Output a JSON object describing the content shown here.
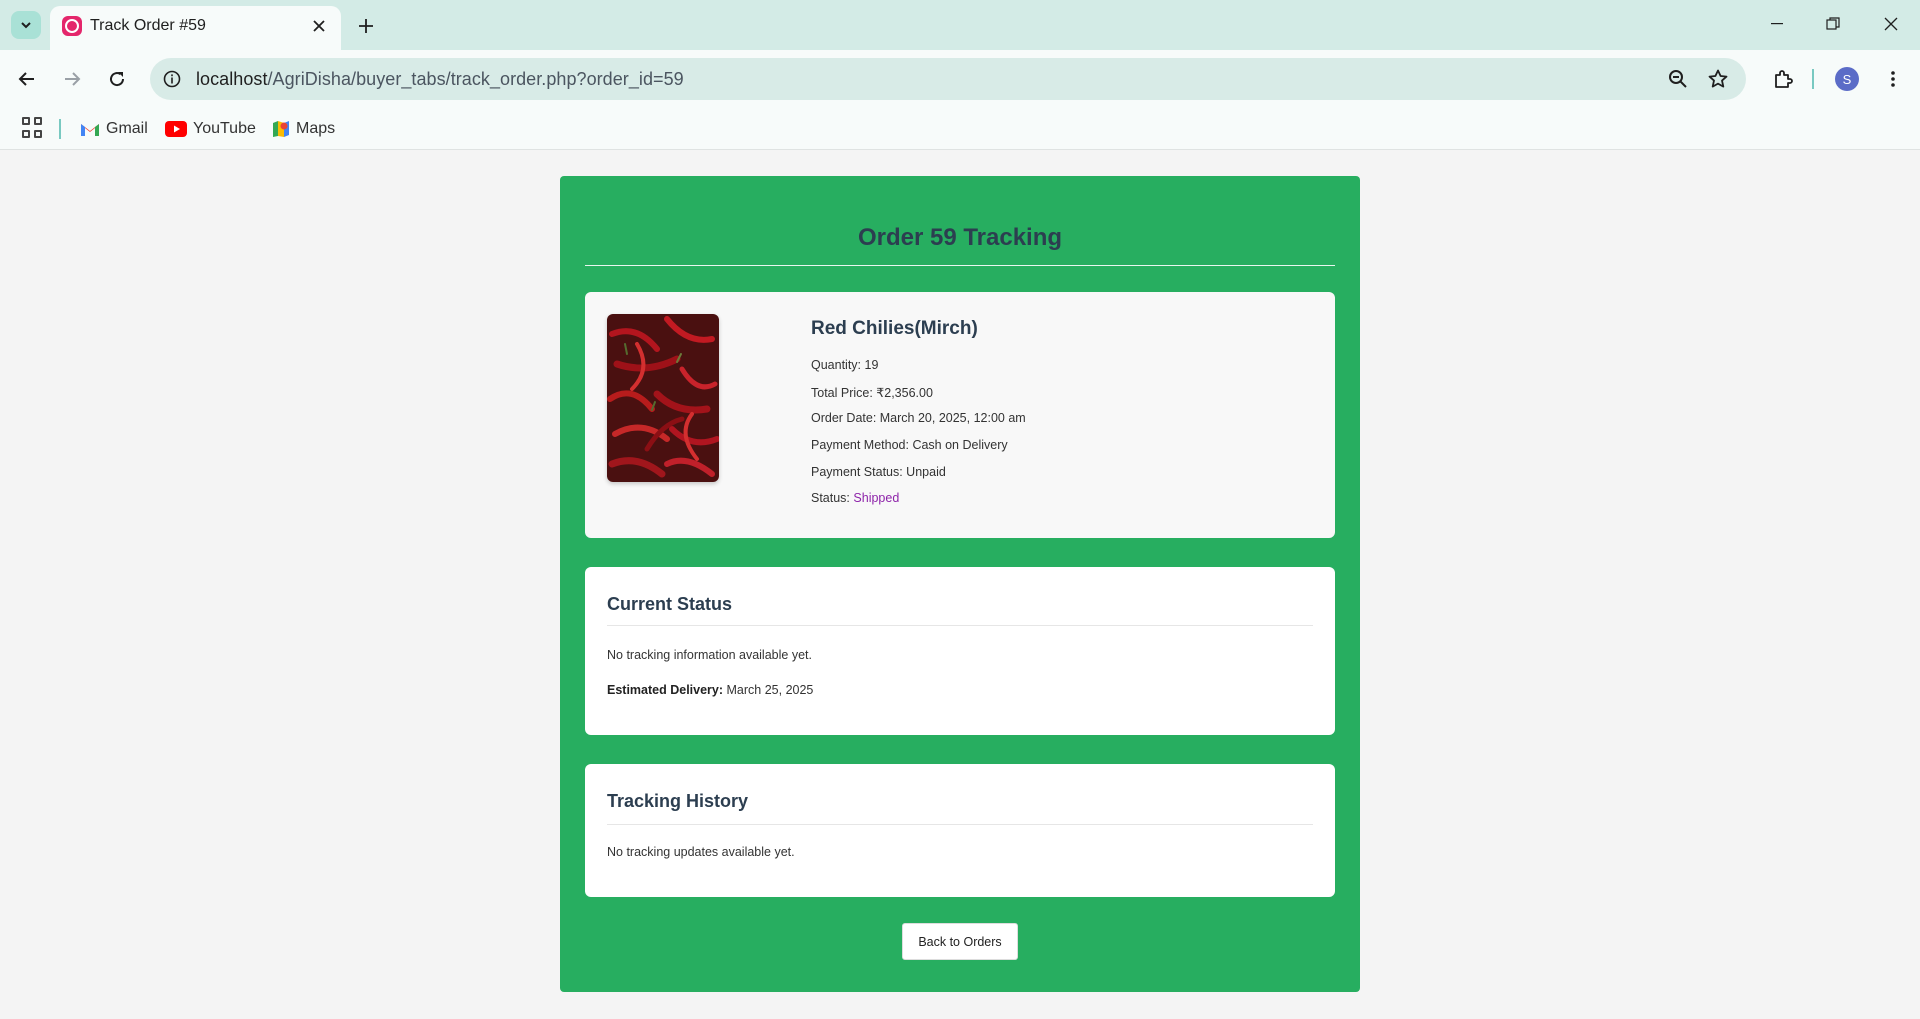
{
  "browser": {
    "tab_title": "Track Order #59",
    "url_host": "localhost",
    "url_path": "/AgriDisha/buyer_tabs/track_order.php?order_id=59",
    "profile_initial": "S",
    "bookmarks": [
      {
        "label": "Gmail",
        "icon": "gmail-icon"
      },
      {
        "label": "YouTube",
        "icon": "youtube-icon"
      },
      {
        "label": "Maps",
        "icon": "maps-icon"
      }
    ]
  },
  "page": {
    "title": "Order 59 Tracking",
    "product": {
      "name": "Red Chilies(Mirch)",
      "quantity": "Quantity: 19",
      "total_price": "Total Price: ₹2,356.00",
      "order_date": "Order Date: March 20, 2025, 12:00 am",
      "payment_method": "Payment Method: Cash on Delivery",
      "payment_status": "Payment Status: Unpaid",
      "status_label": "Status:",
      "status_value": "Shipped"
    },
    "current_status": {
      "heading": "Current Status",
      "message": "No tracking information available yet.",
      "estimated_label": "Estimated Delivery:",
      "estimated_value": "March 25, 2025"
    },
    "tracking_history": {
      "heading": "Tracking History",
      "message": "No tracking updates available yet."
    },
    "back_button": "Back to Orders"
  },
  "colors": {
    "card_green": "#27ae60",
    "heading": "#2c3e50",
    "status_shipped": "#8e24aa"
  }
}
